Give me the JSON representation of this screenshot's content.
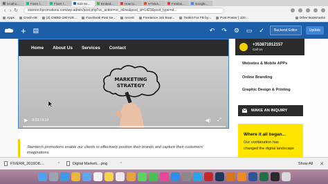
{
  "browser": {
    "tabs": [
      {
        "label": "localho...",
        "color": "#6b6b6b"
      },
      {
        "label": "Fiverr /...",
        "color": "#1dbf73"
      },
      {
        "label": "Fiverr /...",
        "color": "#1dbf73"
      },
      {
        "label": "Edit Se...",
        "color": "#1c5ea8"
      },
      {
        "label": "Embed...",
        "color": "#4caf50"
      },
      {
        "label": "How to...",
        "color": "#e53935"
      },
      {
        "label": "HTML5...",
        "color": "#e44d26"
      },
      {
        "label": "Freelan...",
        "color": "#e53935"
      },
      {
        "label": "Google...",
        "color": "#4285f4"
      }
    ],
    "active_tab_index": 3,
    "url": "stantorchpromotions.com/wp-admin/post.php?vc_action=vc_inline&post_id=1423&post_type=st...",
    "bookmarks": [
      "Apps",
      "Crash-08",
      "(3) CMBD-190YVE...",
      "Facebook Post Se...",
      "recent",
      "Freelance Job Boar...",
      "Toolkit For FB by...",
      "Post Poster | 100..."
    ],
    "other_bookmarks": "Other Bookmarks"
  },
  "editor": {
    "backend_editor_label": "Backend Editor",
    "update_label": "Update"
  },
  "site": {
    "nav": [
      "Home",
      "About Us",
      "Services",
      "Contact"
    ],
    "hero": {
      "cloud_text": "MARKETING STRATEGY",
      "time": "0:03 / 0:19"
    },
    "quote": "Stantorch promotions enable our clients to effectively position their brands and capture their customers' imaginations.",
    "sidebar": {
      "phone": "+353871912157",
      "call_label": "Call Us",
      "services": [
        "Websites & Mobile APPs",
        "Online Branding",
        "Graphic Design & Printing"
      ],
      "inquiry_label": "MAKE AN INQUIRY",
      "promo_title": "Where it all began...",
      "promo_text_1": "Our combination has",
      "promo_text_2": "changed the digital landscape"
    }
  },
  "downloads": {
    "items": [
      "FIVERR_2019O8....",
      "Digital Marketi....png"
    ],
    "show_all": "Show All"
  },
  "dock": {
    "icons": [
      {
        "name": "finder",
        "color": "#4da3f0"
      },
      {
        "name": "launchpad",
        "color": "#9aa4b2"
      },
      {
        "name": "safari",
        "color": "#3d9be9"
      },
      {
        "name": "chrome",
        "color": "#e9ba3a"
      },
      {
        "name": "mail",
        "color": "#5fa8ea"
      },
      {
        "name": "calendar",
        "color": "#f2f2f2"
      },
      {
        "name": "notes",
        "color": "#f5d547"
      },
      {
        "name": "reminders",
        "color": "#eaeaea"
      },
      {
        "name": "photos",
        "color": "#e7a33e"
      },
      {
        "name": "messages",
        "color": "#5ad35f"
      },
      {
        "name": "facetime",
        "color": "#4ac14f"
      },
      {
        "name": "itunes",
        "color": "#e8479a"
      },
      {
        "name": "appstore",
        "color": "#2d8fe8"
      },
      {
        "name": "preferences",
        "color": "#8a8a8a"
      },
      {
        "name": "skype",
        "color": "#2aa6e8"
      },
      {
        "name": "filezilla",
        "color": "#c62828"
      },
      {
        "name": "photoshop",
        "color": "#1e3a5f"
      },
      {
        "name": "illustrator",
        "color": "#d6771a"
      },
      {
        "name": "vlc",
        "color": "#f08a1c"
      },
      {
        "name": "word",
        "color": "#2b5797"
      },
      {
        "name": "excel",
        "color": "#1d7044"
      },
      {
        "name": "terminal",
        "color": "#2a2a2a"
      },
      {
        "name": "trash",
        "color": "#d9d9d9"
      }
    ]
  }
}
